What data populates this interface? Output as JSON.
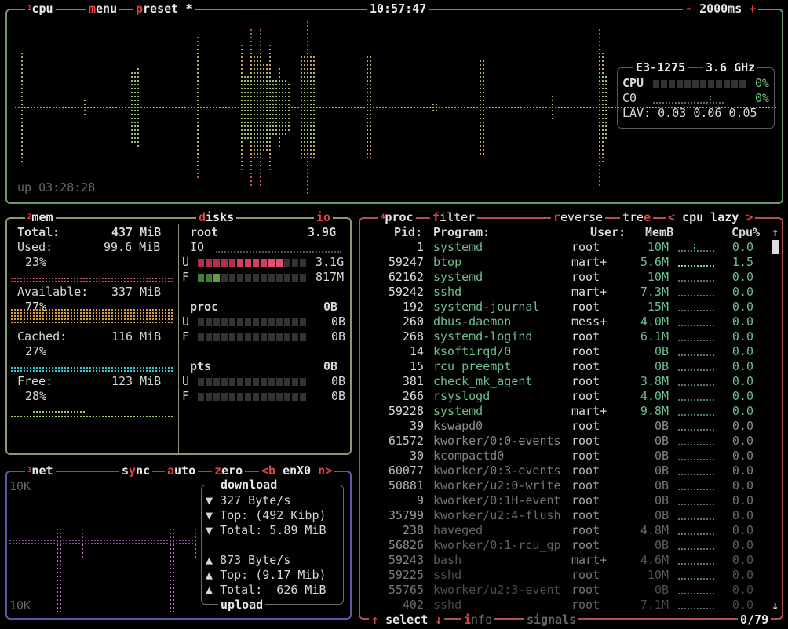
{
  "cpu": {
    "hotkey_num": "1",
    "title": "cpu",
    "menu_hotkey": "m",
    "menu_rest": "enu",
    "preset_hotkey": "p",
    "preset_rest": "reset *",
    "clock": "10:57:47",
    "minus": "-",
    "interval": "2000ms",
    "plus": "+",
    "model": "E3-1275",
    "freq": "3.6 GHz",
    "cpu_label": "CPU",
    "cpu_pct": "0%",
    "c0_label": "C0",
    "c0_pct": "0%",
    "lav_label": "LAV:",
    "lav1": "0.03",
    "lav5": "0.06",
    "lav15": "0.05",
    "uptime": "up 03:28:28"
  },
  "mem": {
    "hotkey_num": "2",
    "title": "mem",
    "total_label": "Total:",
    "total_value": "437 MiB",
    "used_label": "Used:",
    "used_value": "99.6 MiB",
    "used_pct": "23%",
    "avail_label": "Available:",
    "avail_value": "337 MiB",
    "avail_pct": "77%",
    "cached_label": "Cached:",
    "cached_value": "116 MiB",
    "cached_pct": "27%",
    "free_label": "Free:",
    "free_value": "123 MiB",
    "free_pct": "28%",
    "colors": {
      "used": "#d05070",
      "avail": "#d8a040",
      "cached": "#40c8d0",
      "free": "#a0d060"
    }
  },
  "disks": {
    "hotkey": "d",
    "title_rest": "isks",
    "io_hotkey": "io",
    "root_name": "root",
    "root_size": "3.9G",
    "root_io": "IO",
    "root_used_label": "U",
    "root_used": "3.1G",
    "root_used_frac": 0.79,
    "root_free_label": "F",
    "root_free": "817M",
    "root_free_frac": 0.21,
    "proc_name": "proc",
    "proc_size": "0B",
    "proc_used_label": "U",
    "proc_used": "0B",
    "proc_free_label": "F",
    "proc_free": "0B",
    "pts_name": "pts",
    "pts_size": "0B",
    "pts_used_label": "U",
    "pts_used": "0B",
    "pts_free_label": "F",
    "pts_free": "0B"
  },
  "net": {
    "hotkey_num": "3",
    "title": "net",
    "sync_pre": "s",
    "sync_hotkey": "y",
    "sync_rest": "nc",
    "auto_hotkey": "a",
    "auto_rest": "uto",
    "zero_hotkey": "z",
    "zero_rest": "ero",
    "prev": "<b",
    "iface": "enX0",
    "next": "n>",
    "scale_top": "10K",
    "scale_bottom": "10K",
    "download_label": "download",
    "down_rate": "327 Byte/s",
    "down_top": "Top: (492 Kibp)",
    "down_total": "Total: 5.89 MiB",
    "up_rate": "873 Byte/s",
    "up_top": "Top: (9.17 Mib)",
    "up_total": "Total:  626 MiB",
    "upload_label": "upload",
    "down_arrow": "▼",
    "up_arrow": "▲"
  },
  "proc": {
    "hotkey_num": "4",
    "title": "proc",
    "filter_hotkey": "f",
    "filter_rest": "ilter",
    "reverse_hotkey": "r",
    "reverse_rest": "everse",
    "tree_pre": "tre",
    "tree_hotkey": "e",
    "sort_prev": "<",
    "sort": "cpu lazy",
    "sort_next": ">",
    "headers": {
      "pid": "Pid:",
      "program": "Program:",
      "user": "User:",
      "mem": "MemB",
      "cpu": "Cpu%"
    },
    "rows": [
      {
        "pid": "1",
        "program": "systemd",
        "user": "root",
        "mem": "10M",
        "cpu": "0.0"
      },
      {
        "pid": "59247",
        "program": "btop",
        "user": "mart+",
        "mem": "5.6M",
        "cpu": "1.5"
      },
      {
        "pid": "62162",
        "program": "systemd",
        "user": "root",
        "mem": "10M",
        "cpu": "0.0"
      },
      {
        "pid": "59242",
        "program": "sshd",
        "user": "mart+",
        "mem": "7.3M",
        "cpu": "0.0"
      },
      {
        "pid": "192",
        "program": "systemd-journal",
        "user": "root",
        "mem": "15M",
        "cpu": "0.0"
      },
      {
        "pid": "260",
        "program": "dbus-daemon",
        "user": "mess+",
        "mem": "4.0M",
        "cpu": "0.0"
      },
      {
        "pid": "268",
        "program": "systemd-logind",
        "user": "root",
        "mem": "6.1M",
        "cpu": "0.0"
      },
      {
        "pid": "14",
        "program": "ksoftirqd/0",
        "user": "root",
        "mem": "0B",
        "cpu": "0.0"
      },
      {
        "pid": "15",
        "program": "rcu_preempt",
        "user": "root",
        "mem": "0B",
        "cpu": "0.0"
      },
      {
        "pid": "381",
        "program": "check_mk_agent",
        "user": "root",
        "mem": "3.8M",
        "cpu": "0.0"
      },
      {
        "pid": "266",
        "program": "rsyslogd",
        "user": "root",
        "mem": "4.0M",
        "cpu": "0.0"
      },
      {
        "pid": "59228",
        "program": "systemd",
        "user": "mart+",
        "mem": "9.8M",
        "cpu": "0.0"
      },
      {
        "pid": "39",
        "program": "kswapd0",
        "user": "root",
        "mem": "0B",
        "cpu": "0.0"
      },
      {
        "pid": "61572",
        "program": "kworker/0:0-events",
        "user": "root",
        "mem": "0B",
        "cpu": "0.0"
      },
      {
        "pid": "30",
        "program": "kcompactd0",
        "user": "root",
        "mem": "0B",
        "cpu": "0.0"
      },
      {
        "pid": "60077",
        "program": "kworker/0:3-events",
        "user": "root",
        "mem": "0B",
        "cpu": "0.0"
      },
      {
        "pid": "50881",
        "program": "kworker/u2:0-write",
        "user": "root",
        "mem": "0B",
        "cpu": "0.0"
      },
      {
        "pid": "9",
        "program": "kworker/0:1H-event",
        "user": "root",
        "mem": "0B",
        "cpu": "0.0"
      },
      {
        "pid": "35799",
        "program": "kworker/u2:4-flush",
        "user": "root",
        "mem": "0B",
        "cpu": "0.0"
      },
      {
        "pid": "238",
        "program": "haveged",
        "user": "root",
        "mem": "4.8M",
        "cpu": "0.0"
      },
      {
        "pid": "56826",
        "program": "kworker/0:1-rcu_gp",
        "user": "root",
        "mem": "0B",
        "cpu": "0.0"
      },
      {
        "pid": "59243",
        "program": "bash",
        "user": "mart+",
        "mem": "4.6M",
        "cpu": "0.0"
      },
      {
        "pid": "59225",
        "program": "sshd",
        "user": "root",
        "mem": "10M",
        "cpu": "0.0"
      },
      {
        "pid": "55765",
        "program": "kworker/u2:3-event",
        "user": "root",
        "mem": "0B",
        "cpu": "0.0"
      },
      {
        "pid": "402",
        "program": "sshd",
        "user": "root",
        "mem": "7.1M",
        "cpu": "0.0"
      }
    ],
    "select_up": "↑",
    "select_label": "select",
    "select_down": "↓",
    "info_hotkey": "i",
    "info_rest": "nfo",
    "signals_label": "signals",
    "count": "0/79",
    "scroll_up": "↑",
    "scroll_down": "↓"
  }
}
